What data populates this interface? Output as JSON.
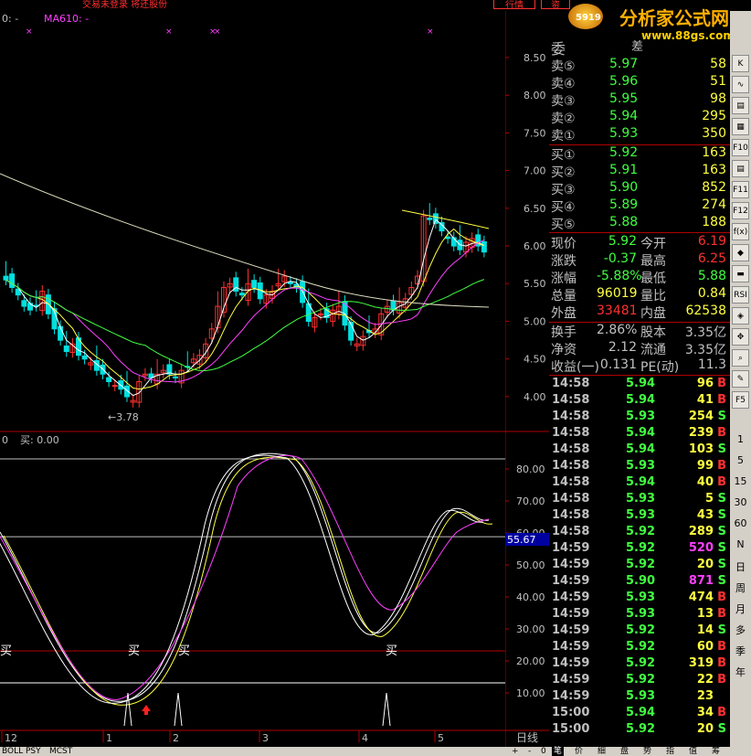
{
  "topbar": {
    "left_text": "交易未登录 将还股份",
    "buttons": [
      "行情",
      "资"
    ],
    "watermark_main": "分析家公式网",
    "watermark_url": "www.88gs.com",
    "watermark_badge": "5919"
  },
  "price_chart": {
    "ma_label": "MA610: -",
    "ma_prefix": "0: -",
    "low_marker": "←3.78",
    "y_ticks": [
      "8.50",
      "8.00",
      "7.50",
      "7.00",
      "6.50",
      "6.00",
      "5.50",
      "5.00",
      "4.50",
      "4.00"
    ]
  },
  "indicator": {
    "header_left": "0",
    "header_buy": "买: 0.00",
    "y_ticks": [
      "80.00",
      "70.00",
      "60.00",
      "50.00",
      "40.00",
      "30.00",
      "20.00",
      "10.00"
    ],
    "current_value": "55.67",
    "buy_labels": [
      "买",
      "买",
      "买",
      "买"
    ]
  },
  "x_axis": {
    "labels": [
      "12",
      "1",
      "2",
      "3",
      "4",
      "5"
    ],
    "period": "日线"
  },
  "bottom_tabs": [
    "BOLL",
    "PSY",
    "MCST"
  ],
  "bottom_right_tabs": [
    "+",
    "-",
    "0"
  ],
  "orderbook": {
    "header": "委",
    "header_right": "差",
    "sell": [
      {
        "label": "卖⑤",
        "price": "5.97",
        "vol": "58"
      },
      {
        "label": "卖④",
        "price": "5.96",
        "vol": "51"
      },
      {
        "label": "卖③",
        "price": "5.95",
        "vol": "98"
      },
      {
        "label": "卖②",
        "price": "5.94",
        "vol": "295"
      },
      {
        "label": "卖①",
        "price": "5.93",
        "vol": "350"
      }
    ],
    "buy": [
      {
        "label": "买①",
        "price": "5.92",
        "vol": "163"
      },
      {
        "label": "买②",
        "price": "5.91",
        "vol": "163"
      },
      {
        "label": "买③",
        "price": "5.90",
        "vol": "852"
      },
      {
        "label": "买④",
        "price": "5.89",
        "vol": "274"
      },
      {
        "label": "买⑤",
        "price": "5.88",
        "vol": "188"
      }
    ]
  },
  "quote": {
    "rows": [
      {
        "l1": "现价",
        "v1": "5.92",
        "l2": "今开",
        "v2": "6.19"
      },
      {
        "l1": "涨跌",
        "v1": "-0.37",
        "l2": "最高",
        "v2": "6.25"
      },
      {
        "l1": "涨幅",
        "v1": "-5.88%",
        "l2": "最低",
        "v2": "5.88"
      },
      {
        "l1": "总量",
        "v1": "96019",
        "l2": "量比",
        "v2": "0.84"
      },
      {
        "l1": "外盘",
        "v1": "33481",
        "l2": "内盘",
        "v2": "62538"
      }
    ],
    "rows2": [
      {
        "l1": "换手",
        "v1": "2.86%",
        "l2": "股本",
        "v2": "3.35亿"
      },
      {
        "l1": "净资",
        "v1": "2.12",
        "l2": "流通",
        "v2": "3.35亿"
      },
      {
        "l1": "收益(一)",
        "v1": "0.131",
        "l2": "PE(动)",
        "v2": "11.3"
      }
    ]
  },
  "ticks": [
    {
      "time": "14:58",
      "price": "5.94",
      "vol": "96",
      "side": "B"
    },
    {
      "time": "14:58",
      "price": "5.94",
      "vol": "41",
      "side": "B"
    },
    {
      "time": "14:58",
      "price": "5.93",
      "vol": "254",
      "side": "S"
    },
    {
      "time": "14:58",
      "price": "5.94",
      "vol": "239",
      "side": "B"
    },
    {
      "time": "14:58",
      "price": "5.94",
      "vol": "103",
      "side": "S"
    },
    {
      "time": "14:58",
      "price": "5.93",
      "vol": "99",
      "side": "B"
    },
    {
      "time": "14:58",
      "price": "5.94",
      "vol": "40",
      "side": "B"
    },
    {
      "time": "14:58",
      "price": "5.93",
      "vol": "5",
      "side": "S"
    },
    {
      "time": "14:58",
      "price": "5.93",
      "vol": "43",
      "side": "S"
    },
    {
      "time": "14:58",
      "price": "5.92",
      "vol": "289",
      "side": "S"
    },
    {
      "time": "14:59",
      "price": "5.92",
      "vol": "520",
      "side": "S"
    },
    {
      "time": "14:59",
      "price": "5.92",
      "vol": "20",
      "side": "S"
    },
    {
      "time": "14:59",
      "price": "5.90",
      "vol": "871",
      "side": "S"
    },
    {
      "time": "14:59",
      "price": "5.93",
      "vol": "474",
      "side": "B"
    },
    {
      "time": "14:59",
      "price": "5.93",
      "vol": "13",
      "side": "B"
    },
    {
      "time": "14:59",
      "price": "5.92",
      "vol": "14",
      "side": "S"
    },
    {
      "time": "14:59",
      "price": "5.92",
      "vol": "60",
      "side": "B"
    },
    {
      "time": "14:59",
      "price": "5.92",
      "vol": "319",
      "side": "B"
    },
    {
      "time": "14:59",
      "price": "5.92",
      "vol": "22",
      "side": "B"
    },
    {
      "time": "14:59",
      "price": "5.93",
      "vol": "23",
      "side": ""
    },
    {
      "time": "15:00",
      "price": "5.94",
      "vol": "34",
      "side": "B"
    },
    {
      "time": "15:00",
      "price": "5.92",
      "vol": "20",
      "side": "S"
    }
  ],
  "right_panel_tabs": [
    "笔",
    "价",
    "细",
    "盘",
    "势",
    "指",
    "值",
    "筹"
  ],
  "toolbar": {
    "buttons": [
      "K",
      "∿",
      "▤",
      "▦",
      "F10",
      "▤",
      "F11",
      "F12",
      "f(x)",
      "◆",
      "▬",
      "RSI",
      "◈",
      "✥",
      "⌕",
      "✎",
      "F5"
    ],
    "periods": [
      "1",
      "5",
      "15",
      "30",
      "60",
      "N",
      "日",
      "周",
      "月",
      "多",
      "季",
      "年"
    ]
  },
  "colors": {
    "up": "#ff3030",
    "down": "#00e0e0",
    "green": "#40ff40",
    "yellow": "#ffff40",
    "magenta": "#ff40ff"
  }
}
